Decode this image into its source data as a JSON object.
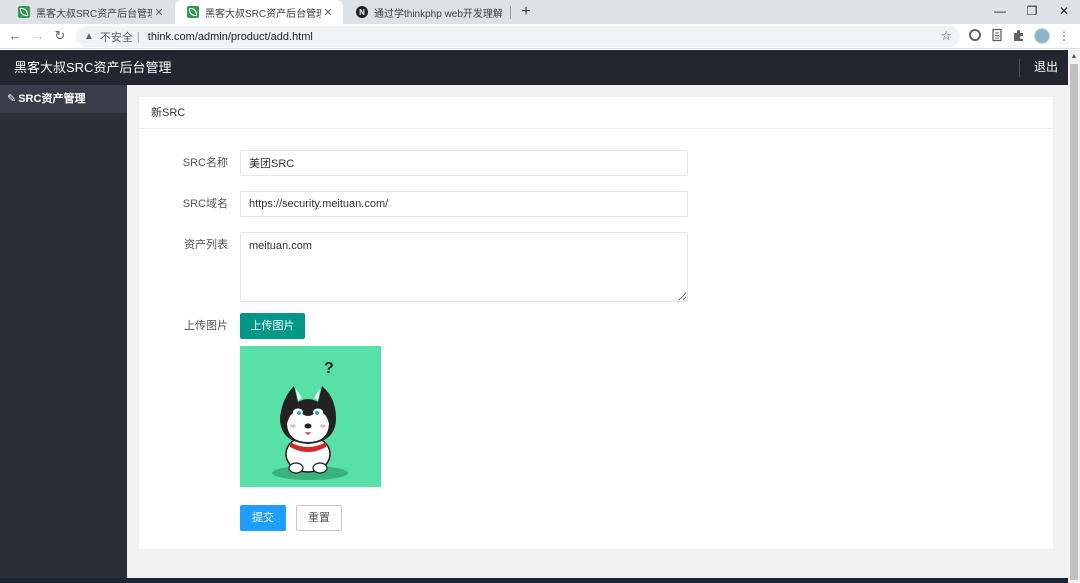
{
  "browser": {
    "tabs": [
      {
        "title": "黑客大叔SRC资产后台管理",
        "close": "✕",
        "active": false
      },
      {
        "title": "黑客大叔SRC资产后台管理",
        "close": "✕",
        "active": true
      },
      {
        "title": "通过学thinkphp web开发理解漏",
        "close": "✕",
        "favicon_letter": "N",
        "active": false
      }
    ],
    "new_tab": "+",
    "window_controls": {
      "minimize": "—",
      "restore": "❐",
      "close": "✕"
    },
    "nav": {
      "back": "←",
      "forward": "→",
      "reload": "↻"
    },
    "address": {
      "warning_icon": "▲",
      "insecure_label": "不安全",
      "separator": "|",
      "url": "think.com/admin/product/add.html",
      "star": "☆"
    },
    "toolbar_icons": [
      "circle-extension-icon",
      "reader-icon",
      "puzzle-icon",
      "profile-icon",
      "menu-icon"
    ],
    "menu": "⋮"
  },
  "app": {
    "title": "黑客大叔SRC资产后台管理",
    "logout": "退出"
  },
  "sidebar": {
    "items": [
      {
        "label": "SRC资产管理",
        "icon": "pencil-icon",
        "icon_glyph": "✎",
        "active": true
      }
    ]
  },
  "form": {
    "heading": "新SRC",
    "fields": {
      "name": {
        "label": "SRC名称",
        "value": "美团SRC"
      },
      "domain": {
        "label": "SRC域名",
        "value": "https://security.meituan.com/"
      },
      "assets": {
        "label": "资产列表",
        "value": "meituan.com"
      },
      "image": {
        "label": "上传图片",
        "button": "上传图片"
      }
    },
    "submit": "提交",
    "reset": "重置"
  },
  "preview": {
    "question_mark": "?",
    "background": "#57e0a7"
  },
  "colors": {
    "header_bg": "#23262e",
    "sidebar_bg": "#2b2e37",
    "sidebar_active": "#393d49",
    "upload_btn": "#009688",
    "submit_btn": "#1e9fff"
  }
}
